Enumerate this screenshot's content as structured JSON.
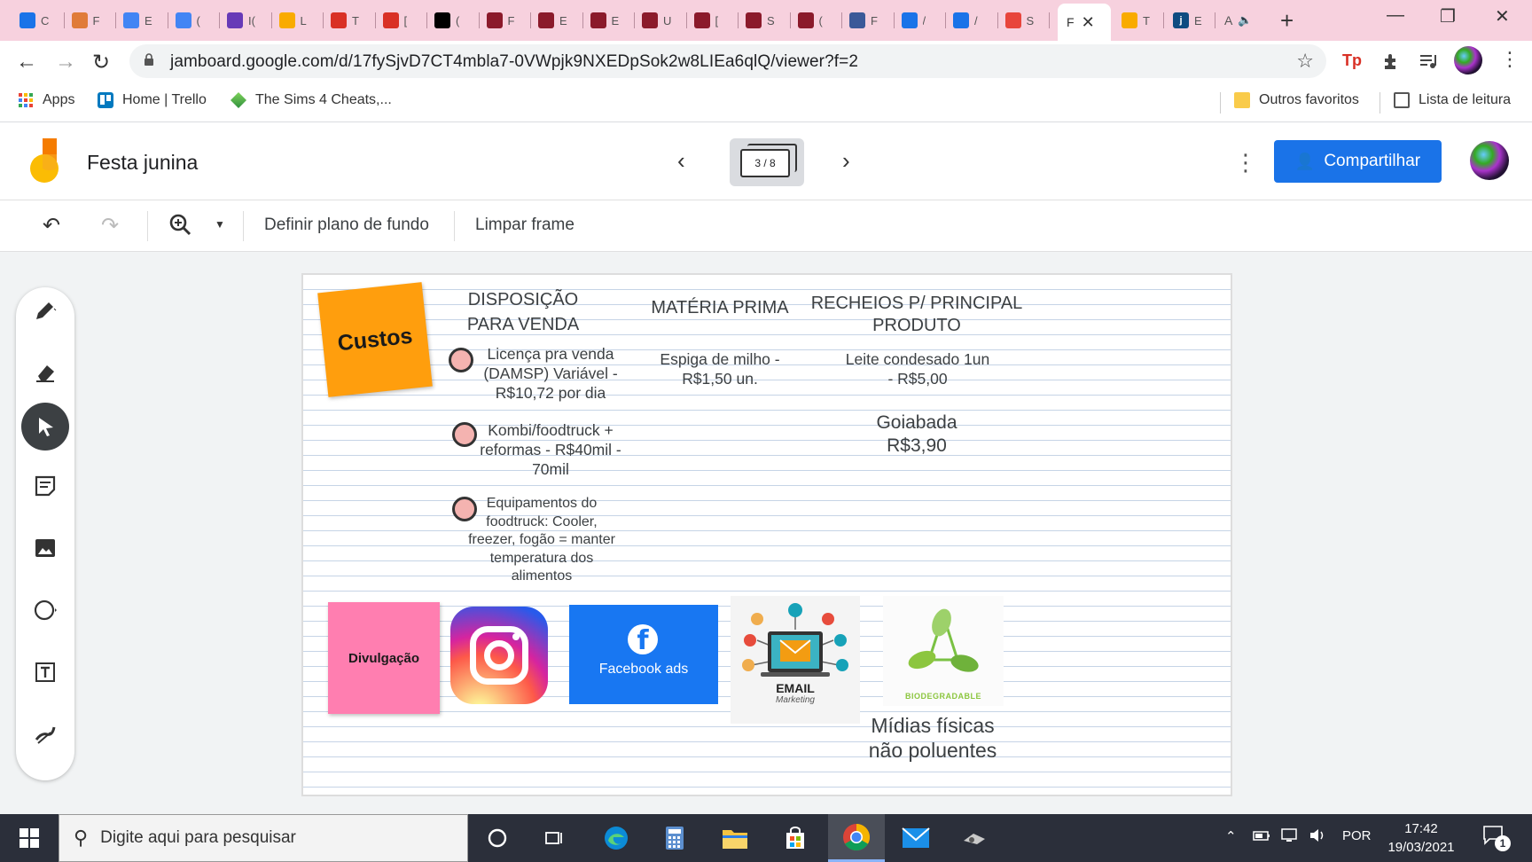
{
  "browser": {
    "tabs": [
      {
        "icon": "tab-favicon-1",
        "color": "#1a73e8",
        "label": "C"
      },
      {
        "icon": "tab-favicon-2",
        "color": "#e07b39",
        "label": "F"
      },
      {
        "icon": "tab-favicon-google",
        "color": "#4285f4",
        "label": "E"
      },
      {
        "icon": "tab-favicon-google",
        "color": "#4285f4",
        "label": "("
      },
      {
        "icon": "tab-favicon-forms",
        "color": "#673ab7",
        "label": "I("
      },
      {
        "icon": "tab-favicon-5",
        "color": "#f9ab00",
        "label": "L"
      },
      {
        "icon": "tab-favicon-6",
        "color": "#d93025",
        "label": "T"
      },
      {
        "icon": "tab-favicon-gmail",
        "color": "#d93025",
        "label": "["
      },
      {
        "icon": "tab-favicon-wikipedia",
        "color": "#000000",
        "label": "("
      },
      {
        "icon": "tab-favicon-10",
        "color": "#8b1a2b",
        "label": "F"
      },
      {
        "icon": "tab-favicon-11",
        "color": "#8b1a2b",
        "label": "E"
      },
      {
        "icon": "tab-favicon-12",
        "color": "#8b1a2b",
        "label": "E"
      },
      {
        "icon": "tab-favicon-13",
        "color": "#8b1a2b",
        "label": "U"
      },
      {
        "icon": "tab-favicon-14",
        "color": "#8b1a2b",
        "label": "["
      },
      {
        "icon": "tab-favicon-15",
        "color": "#8b1a2b",
        "label": "S"
      },
      {
        "icon": "tab-favicon-16",
        "color": "#8b1a2b",
        "label": "("
      },
      {
        "icon": "tab-favicon-17",
        "color": "#3b5998",
        "label": "F"
      },
      {
        "icon": "tab-favicon-18",
        "color": "#1a73e8",
        "label": "/"
      },
      {
        "icon": "tab-favicon-19",
        "color": "#1a73e8",
        "label": "/"
      },
      {
        "icon": "tab-favicon-20",
        "color": "#e8453c",
        "label": "S"
      }
    ],
    "active_tab": {
      "label": "F",
      "close": "✕"
    },
    "tabs_after": [
      {
        "color": "#f9ab00",
        "label": "T"
      },
      {
        "color": "#0f4c81",
        "label": "E"
      }
    ],
    "audio_tab": {
      "label": "A",
      "icon": "🔈"
    },
    "new_tab": "+",
    "window_controls": {
      "minimize": "—",
      "restore": "❐",
      "close": "✕"
    },
    "nav": {
      "back": "←",
      "forward": "→",
      "reload": "↻"
    },
    "url": "jamboard.google.com/d/17fySjvD7CT4mbla7-0VWpjk9NXEDpSok2w8LIEa6qlQ/viewer?f=2",
    "star": "☆",
    "ext_tp": "Tp",
    "menu": "⋮",
    "bookmarks": {
      "apps": "Apps",
      "trello": "Home | Trello",
      "sims": "The Sims 4 Cheats,...",
      "other": "Outros favoritos",
      "reading": "Lista de leitura"
    }
  },
  "jamboard": {
    "title": "Festa junina",
    "frame_counter": "3 / 8",
    "share_label": "Compartilhar",
    "actions": {
      "set_background": "Definir plano de fundo",
      "clear_frame": "Limpar frame"
    },
    "board": {
      "sticky_costs": "Custos",
      "sticky_promo": "Divulgação",
      "heading_sales": "DISPOSIÇÃO PARA VENDA",
      "heading_material": "MATÉRIA PRIMA",
      "heading_fillings": "RECHEIOS P/ PRINCIPAL PRODUTO",
      "item_license": "Licença pra venda (DAMSP) Variável - R$10,72 por dia",
      "item_kombi": "Kombi/foodtruck + reformas - R$40mil - 70mil",
      "item_equipment": "Equipamentos do foodtruck: Cooler, freezer, fogão = manter temperatura dos alimentos",
      "item_corn": "Espiga de milho - R$1,50 un.",
      "item_condensed": "Leite condesado 1un - R$5,00",
      "item_guava": "Goiabada R$3,90",
      "fb_ads": "Facebook ads",
      "email_title": "EMAIL",
      "email_sub": "Marketing",
      "bio_label": "BIODEGRADABLE",
      "physical_media": "Mídias físicas não poluentes"
    }
  },
  "taskbar": {
    "search_placeholder": "Digite aqui para pesquisar",
    "language": "POR",
    "time": "17:42",
    "date": "19/03/2021",
    "notifications": "1"
  },
  "colors": {
    "sticky_orange": "#ff9e0d",
    "sticky_pink": "#ff7eb0",
    "share_blue": "#1a73e8",
    "tabstrip_pink": "#f7d1de",
    "taskbar": "#2b2f3a"
  }
}
